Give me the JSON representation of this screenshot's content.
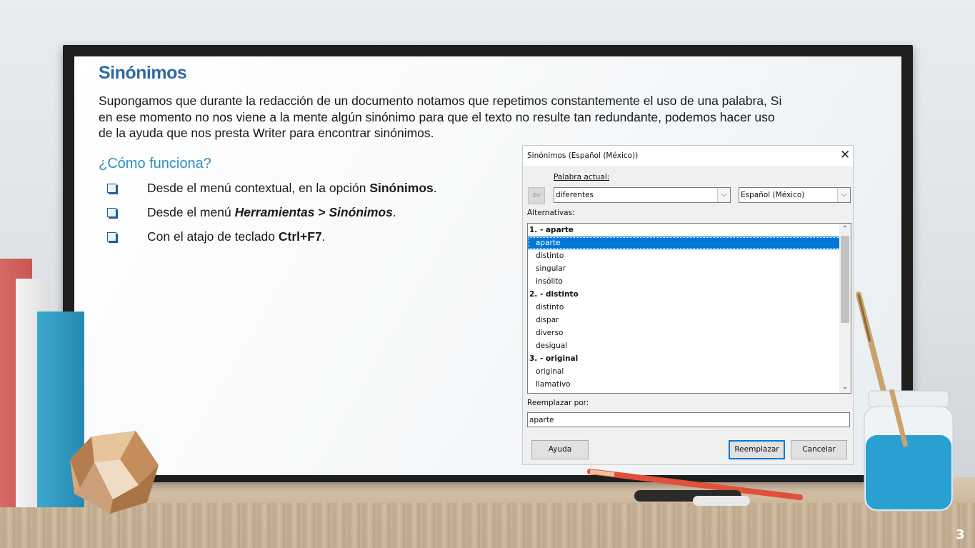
{
  "slide": {
    "title": "Sinónimos",
    "intro": "Supongamos que durante la redacción de un documento notamos que repetimos constantemente el uso de una palabra, Si en ese momento no nos viene a la mente algún sinónimo para que el texto no resulte tan redundante, podemos hacer uso de la ayuda que nos presta Writer para encontrar sinónimos.",
    "howto": "¿Cómo funciona?",
    "bullets": [
      {
        "pre": "Desde el menú contextual, en la opción ",
        "em": "Sinónimos",
        "post": "."
      },
      {
        "pre": "Desde el menú ",
        "em": "Herramientas > Sinónimos",
        "post": "."
      },
      {
        "pre": "Con el atajo de teclado ",
        "em": "Ctrl+F7",
        "post": "."
      }
    ],
    "page_number": "3"
  },
  "dialog": {
    "title": "Sinónimos (Español (México))",
    "close_icon": "close-icon",
    "current_word_label": "Palabra actual:",
    "current_word_value": "diferentes",
    "language_value": "Español (México)",
    "alternatives_label": "Alternativas:",
    "alternatives": [
      {
        "text": "1. - aparte",
        "type": "header"
      },
      {
        "text": "aparte",
        "type": "item",
        "selected": true
      },
      {
        "text": "distinto",
        "type": "item"
      },
      {
        "text": "singular",
        "type": "item"
      },
      {
        "text": "insólito",
        "type": "item"
      },
      {
        "text": "2. - distinto",
        "type": "header"
      },
      {
        "text": "distinto",
        "type": "item"
      },
      {
        "text": "dispar",
        "type": "item"
      },
      {
        "text": "diverso",
        "type": "item"
      },
      {
        "text": "desigual",
        "type": "item"
      },
      {
        "text": "3. - original",
        "type": "header"
      },
      {
        "text": "original",
        "type": "item"
      },
      {
        "text": "llamativo",
        "type": "item"
      }
    ],
    "replace_label": "Reemplazar por:",
    "replace_value": "aparte",
    "buttons": {
      "help": "Ayuda",
      "replace": "Reemplazar",
      "cancel": "Cancelar"
    },
    "colors": {
      "selection": "#0078d7",
      "default_button_border": "#0078d7"
    }
  },
  "colors": {
    "title": "#2f6aa3",
    "howto": "#2d8fc4"
  }
}
